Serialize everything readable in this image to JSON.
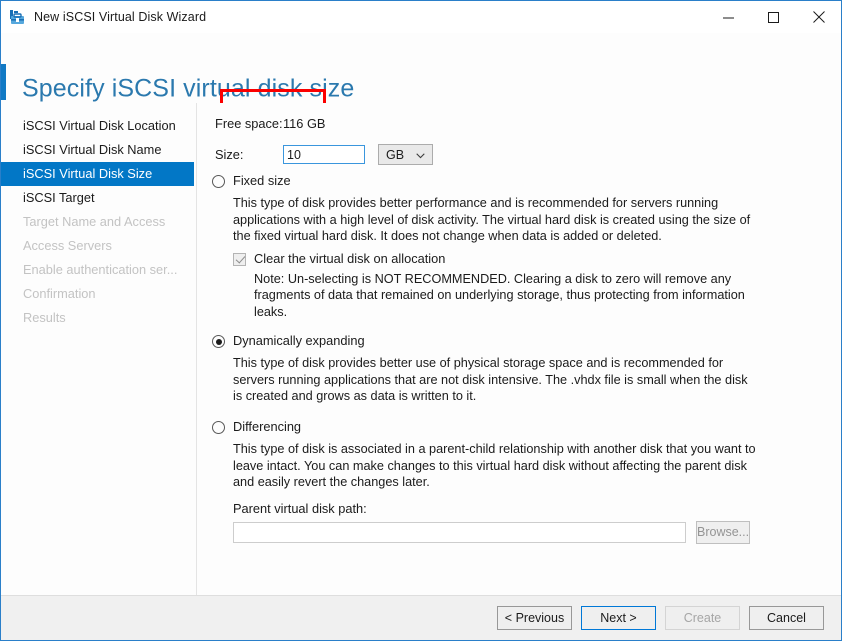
{
  "window": {
    "title": "New iSCSI Virtual Disk Wizard",
    "icon": "wizard-toolbox-icon",
    "border_color": "#2a7fc9",
    "controls": {
      "minimize": "minimize-icon",
      "maximize": "maximize-icon",
      "close": "close-icon"
    }
  },
  "header": {
    "heading": "Specify iSCSI virtual disk size",
    "heading_color": "#2b79ae",
    "accent_color": "#1179c4",
    "annotation": {
      "shape": "rectangle",
      "color": "#fb0000",
      "targets": "disk size"
    }
  },
  "sidebar": {
    "items": [
      {
        "label": "iSCSI Virtual Disk Location",
        "state": "enabled"
      },
      {
        "label": "iSCSI Virtual Disk Name",
        "state": "enabled"
      },
      {
        "label": "iSCSI Virtual Disk Size",
        "state": "selected"
      },
      {
        "label": "iSCSI Target",
        "state": "enabled"
      },
      {
        "label": "Target Name and Access",
        "state": "disabled"
      },
      {
        "label": "Access Servers",
        "state": "disabled"
      },
      {
        "label": "Enable authentication ser...",
        "state": "disabled"
      },
      {
        "label": "Confirmation",
        "state": "disabled"
      },
      {
        "label": "Results",
        "state": "disabled"
      }
    ],
    "selected_color": "#0277c6"
  },
  "content": {
    "free_space": {
      "label": "Free space:",
      "value": "116 GB"
    },
    "size": {
      "label": "Size:",
      "value": "10",
      "unit": "GB",
      "unit_chevron": "chevron-down-icon"
    },
    "options": [
      {
        "id": "fixed-size",
        "label": "Fixed size",
        "selected": false,
        "description": "This type of disk provides better performance and is recommended for servers running applications with a high level of disk activity. The virtual hard disk is created using the size of the fixed virtual hard disk. It does not change when data is added or deleted.",
        "checkbox": {
          "label": "Clear the virtual disk on allocation",
          "checked": true,
          "enabled": false
        },
        "note": "Note: Un-selecting is NOT RECOMMENDED. Clearing a disk to zero will remove any fragments of data that remained on underlying storage, thus protecting from information leaks."
      },
      {
        "id": "dynamically-expanding",
        "label": "Dynamically expanding",
        "selected": true,
        "description": "This type of disk provides better use of physical storage space and is recommended for servers running applications that are not disk intensive. The .vhdx file is small when the disk is created and grows as data is written to it."
      },
      {
        "id": "differencing",
        "label": "Differencing",
        "selected": false,
        "description": "This type of disk is associated in a parent-child relationship with another disk that you want to leave intact. You can make changes to this virtual hard disk without affecting the parent disk and easily revert the changes later."
      }
    ],
    "parent_path": {
      "label": "Parent virtual disk path:",
      "value": "",
      "placeholder": "",
      "browse_label": "Browse...",
      "enabled": false
    }
  },
  "footer": {
    "buttons": [
      {
        "label": "< Previous",
        "state": "enabled"
      },
      {
        "label": "Next >",
        "state": "default"
      },
      {
        "label": "Create",
        "state": "disabled"
      },
      {
        "label": "Cancel",
        "state": "enabled"
      }
    ]
  }
}
